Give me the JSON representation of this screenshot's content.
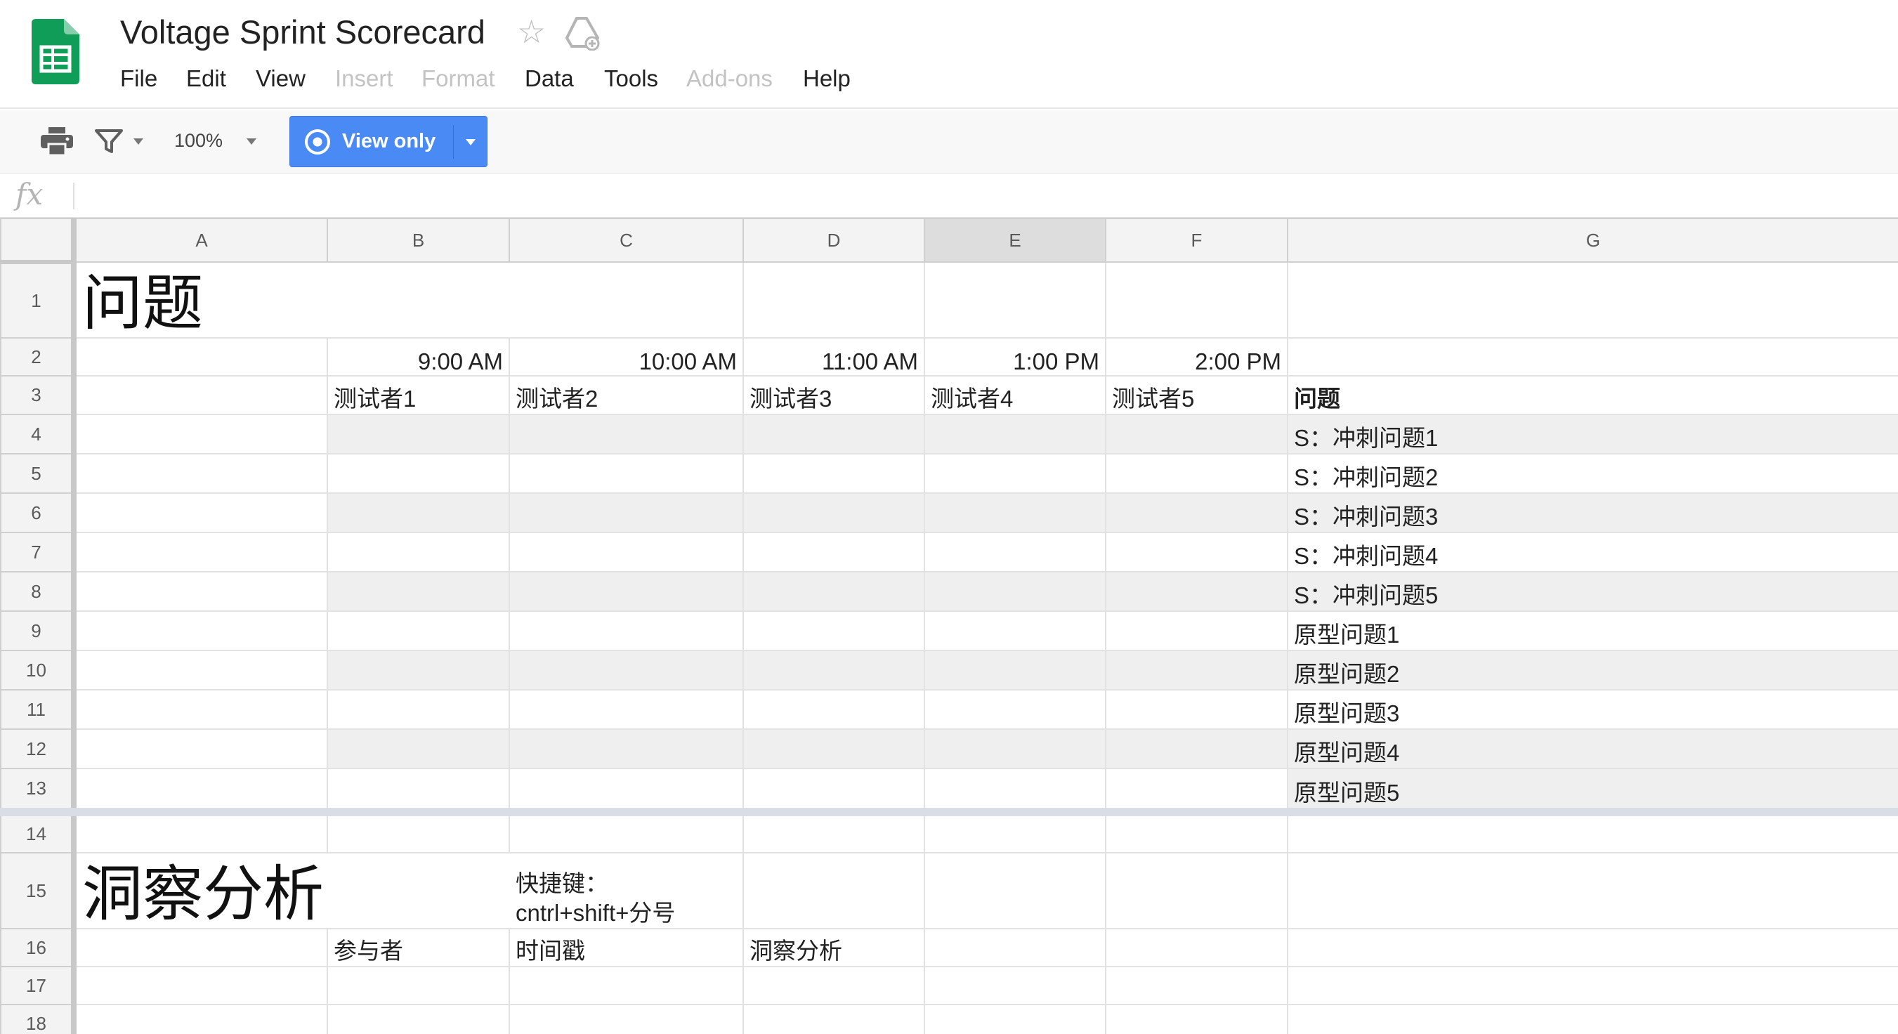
{
  "app": {
    "title": "Voltage Sprint Scorecard",
    "icons": [
      "sheets-logo-icon",
      "star-icon",
      "drive-folder-icon"
    ],
    "colors": {
      "sheets_green": "#0f9d58",
      "view_only_blue": "#4a8af4",
      "band_gray": "#efefef"
    }
  },
  "menu": {
    "file": "File",
    "edit": "Edit",
    "view": "View",
    "insert": "Insert",
    "format": "Format",
    "data": "Data",
    "tools": "Tools",
    "addons": "Add-ons",
    "help": "Help"
  },
  "toolbar": {
    "zoom": "100%",
    "view_only": "View only",
    "icons": [
      "print-icon",
      "filter-icon",
      "eye-icon"
    ]
  },
  "formula_bar": {
    "fx": "fx",
    "value": ""
  },
  "grid": {
    "columns": [
      "A",
      "B",
      "C",
      "D",
      "E",
      "F",
      "G"
    ],
    "selected_column": "E",
    "rows": {
      "r1": {
        "num": "1",
        "a": "问题"
      },
      "r2": {
        "num": "2",
        "b": "9:00 AM",
        "c": "10:00 AM",
        "d": "11:00 AM",
        "e": "1:00 PM",
        "f": "2:00 PM"
      },
      "r3": {
        "num": "3",
        "b": "测试者1",
        "c": "测试者2",
        "d": "测试者3",
        "e": "测试者4",
        "f": "测试者5",
        "g": "问题"
      },
      "r4": {
        "num": "4",
        "g": "S：冲刺问题1"
      },
      "r5": {
        "num": "5",
        "g": "S：冲刺问题2"
      },
      "r6": {
        "num": "6",
        "g": "S：冲刺问题3"
      },
      "r7": {
        "num": "7",
        "g": "S：冲刺问题4"
      },
      "r8": {
        "num": "8",
        "g": "S：冲刺问题5"
      },
      "r9": {
        "num": "9",
        "g": "原型问题1"
      },
      "r10": {
        "num": "10",
        "g": "原型问题2"
      },
      "r11": {
        "num": "11",
        "g": "原型问题3"
      },
      "r12": {
        "num": "12",
        "g": "原型问题4"
      },
      "r13": {
        "num": "13",
        "g": "原型问题5"
      },
      "r14": {
        "num": "14"
      },
      "r15": {
        "num": "15",
        "a": "洞察分析",
        "c1": "快捷键：",
        "c2": "cntrl+shift+分号"
      },
      "r16": {
        "num": "16",
        "b": "参与者",
        "c": "时间戳",
        "d": "洞察分析"
      },
      "r17": {
        "num": "17"
      },
      "r18": {
        "num": "18"
      }
    }
  }
}
